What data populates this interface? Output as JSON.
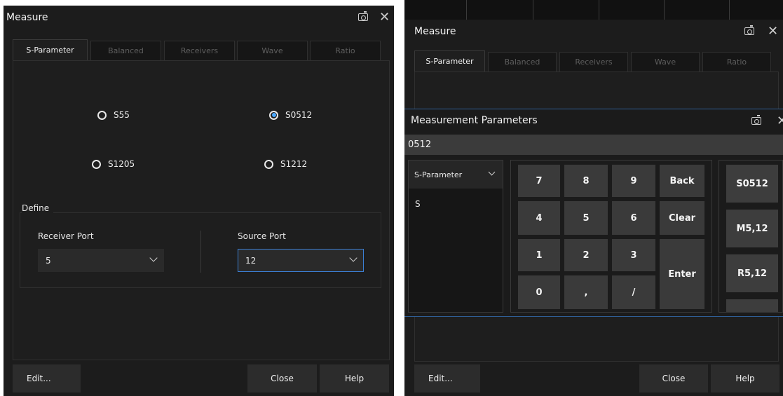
{
  "left": {
    "title": "Measure",
    "tabs": [
      "S-Parameter",
      "Balanced",
      "Receivers",
      "Wave",
      "Ratio"
    ],
    "radios": [
      {
        "label": "S55",
        "selected": false
      },
      {
        "label": "S0512",
        "selected": true
      },
      {
        "label": "S1205",
        "selected": false
      },
      {
        "label": "S1212",
        "selected": false
      }
    ],
    "define": {
      "legend": "Define",
      "receiver_label": "Receiver Port",
      "receiver_value": "5",
      "source_label": "Source Port",
      "source_value": "12"
    },
    "edit_label": "Edit...",
    "close_label": "Close",
    "help_label": "Help"
  },
  "right": {
    "title": "Measure",
    "tabs": [
      "S-Parameter",
      "Balanced",
      "Receivers",
      "Wave",
      "Ratio"
    ],
    "edit_label": "Edit...",
    "close_label": "Close",
    "help_label": "Help"
  },
  "overlay": {
    "title": "Measurement Parameters",
    "input_value": "0512",
    "type_select": "S-Parameter",
    "list_items": [
      "S"
    ],
    "keys": [
      [
        "7",
        "8",
        "9",
        "Back"
      ],
      [
        "4",
        "5",
        "6",
        "Clear"
      ],
      [
        "1",
        "2",
        "3",
        "Enter"
      ],
      [
        "0",
        ",",
        "/"
      ]
    ],
    "results": [
      "S0512",
      "M5,12",
      "R5,12"
    ]
  },
  "colors": {
    "background": "#1c1c1c",
    "accent": "#3b7fd4",
    "radio_selected": "#4aa8ff"
  }
}
